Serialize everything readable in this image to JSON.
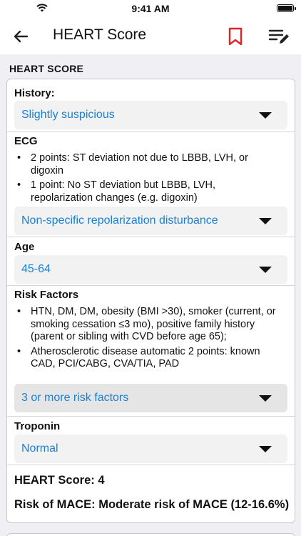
{
  "status_bar": {
    "time": "9:41 AM"
  },
  "nav": {
    "title": "HEART Score"
  },
  "section": {
    "header": "HEART SCORE"
  },
  "history": {
    "label": "History:",
    "selected": "Slightly suspicious"
  },
  "ecg": {
    "label": "ECG",
    "bullets": [
      "2 points: ST deviation not due to LBBB, LVH, or digoxin",
      "1 point: No ST deviation but LBBB, LVH, repolarization changes (e.g. digoxin)"
    ],
    "selected": "Non-specific repolarization disturbance"
  },
  "age": {
    "label": "Age",
    "selected": "45-64"
  },
  "risk_factors": {
    "label": "Risk Factors",
    "bullets": [
      "HTN, DM, DM, obesity (BMI >30), smoker (current, or smoking cessation ≤3 mo), positive family history (parent or sibling with CVD before age 65);",
      "Atherosclerotic disease automatic 2 points: known CAD, PCI/CABG, CVA/TIA, PAD"
    ],
    "selected": "3 or more risk factors"
  },
  "troponin": {
    "label": "Troponin",
    "selected": "Normal"
  },
  "results": {
    "score": "HEART Score: 4",
    "risk": "Risk of MACE: Moderate risk of MACE (12-16.6%)"
  },
  "colors": {
    "accent": "#1a7fd4",
    "bookmark": "#e0242a",
    "background": "#efeff4"
  },
  "icons": {
    "back": "arrow-left-icon",
    "bookmark": "bookmark-icon",
    "edit": "list-edit-icon",
    "wifi": "wifi-icon",
    "battery": "battery-icon"
  }
}
